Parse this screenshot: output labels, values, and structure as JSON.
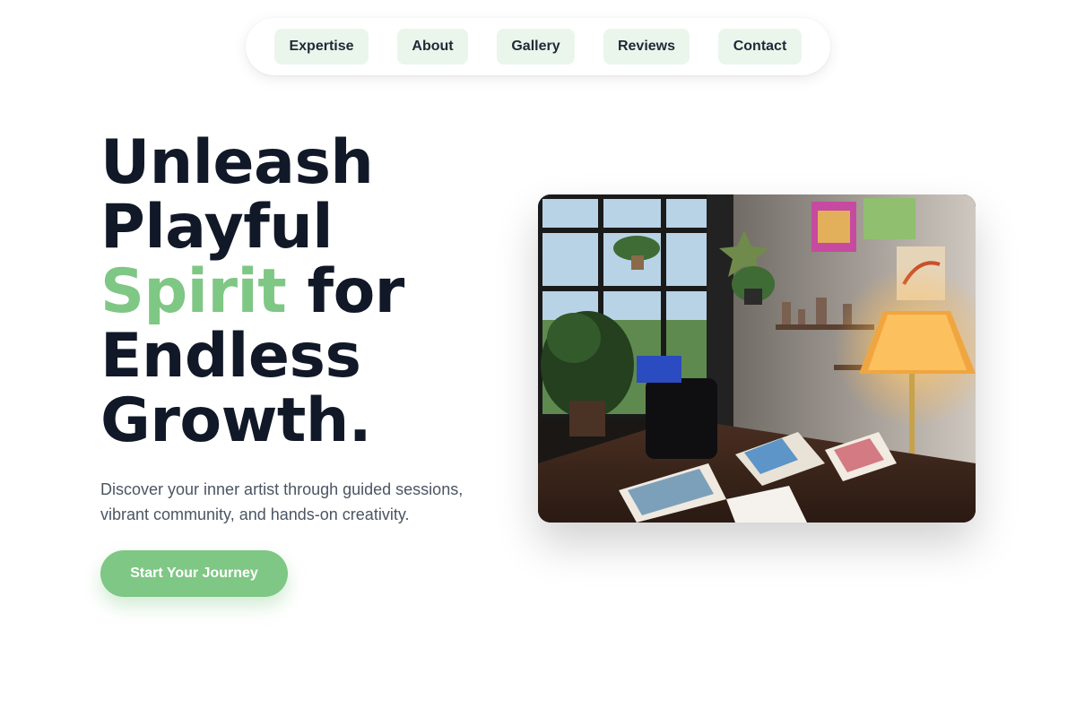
{
  "nav": {
    "items": [
      {
        "label": "Expertise"
      },
      {
        "label": "About"
      },
      {
        "label": "Gallery"
      },
      {
        "label": "Reviews"
      },
      {
        "label": "Contact"
      }
    ]
  },
  "hero": {
    "headline": {
      "line1": "Unleash",
      "line2": "Playful",
      "line3_accent": "Spirit",
      "line3_rest": " for",
      "line4": "Endless",
      "line5": "Growth."
    },
    "subtext": "Discover your inner artist through guided sessions, vibrant community, and hands-on creativity.",
    "cta_label": "Start Your Journey"
  },
  "colors": {
    "accent": "#7fc784",
    "heading": "#111827",
    "nav_pill_bg": "#eaf6ec",
    "body_text": "#4b5563"
  }
}
